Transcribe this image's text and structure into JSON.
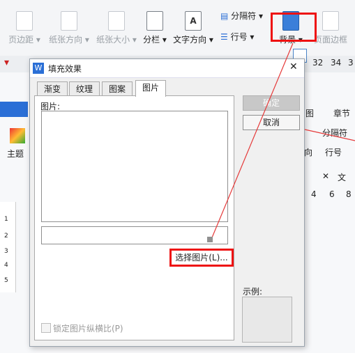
{
  "ribbon": {
    "buttons": [
      {
        "label": "页边距",
        "active": false
      },
      {
        "label": "纸张方向",
        "active": false
      },
      {
        "label": "纸张大小",
        "active": false
      },
      {
        "label": "分栏",
        "active": true
      },
      {
        "label": "文字方向",
        "active": true
      }
    ],
    "section_break": "分隔符",
    "line_number": "行号",
    "background": "背景",
    "page_border": "页面边框",
    "row2_numbers": [
      "32",
      "34",
      "3"
    ]
  },
  "back_window": {
    "tab_view": "图",
    "tab_chapter": "章节",
    "theme_label": "主题",
    "section_break": "分隔符",
    "line_number": "行号",
    "direction_partial": "向",
    "ruler_numbers": [
      "4",
      "6",
      "8"
    ],
    "doc_tab_partial": "文",
    "ruler_left": [
      "1",
      "2",
      "3",
      "4",
      "5"
    ]
  },
  "dialog": {
    "title": "填充效果",
    "tabs": [
      "渐变",
      "纹理",
      "图案",
      "图片"
    ],
    "active_tab": 3,
    "picture_label": "图片:",
    "select_picture": "选择图片(L)...",
    "lock_ratio": "锁定图片纵横比(P)",
    "ok": "确定",
    "cancel": "取消",
    "example_label": "示例:"
  },
  "colors": {
    "highlight": "#e11111",
    "arrow": "#e53939",
    "wps_blue": "#2b6fd6"
  }
}
